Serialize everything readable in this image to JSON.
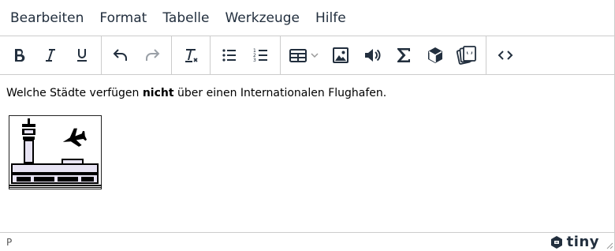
{
  "menubar": {
    "items": [
      "Bearbeiten",
      "Format",
      "Tabelle",
      "Werkzeuge",
      "Hilfe"
    ]
  },
  "toolbar": {
    "groups": [
      [
        "bold-icon",
        "italic-icon",
        "underline-icon"
      ],
      [
        "undo-icon",
        "redo-icon"
      ],
      [
        "clear-formatting-icon"
      ],
      [
        "bullet-list-icon",
        "numbered-list-icon"
      ],
      [
        "table-icon",
        "image-icon",
        "audio-icon",
        "sum-icon",
        "cube-icon",
        "cards-icon"
      ],
      [
        "code-icon"
      ]
    ],
    "disabled": [
      "redo-icon"
    ]
  },
  "content": {
    "text_before": "Welche Städte verfügen ",
    "text_bold": "nicht",
    "text_after": " über einen Internationalen Flughafen.",
    "image": "airport-pictogram"
  },
  "statusbar": {
    "path": "P",
    "brand": "tiny"
  },
  "colors": {
    "text": "#222f3e",
    "border": "#cccccc",
    "airport_fill": "#e8e4f4"
  }
}
